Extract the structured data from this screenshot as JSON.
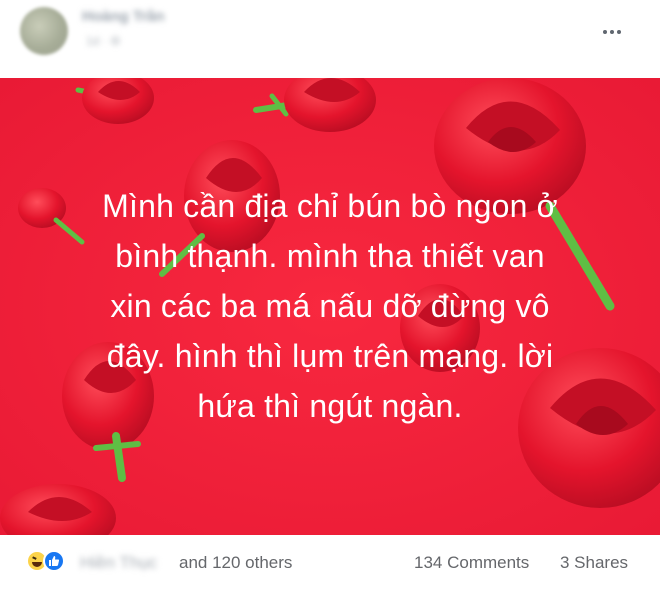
{
  "post": {
    "author_name": "Hoàng Trần",
    "meta": "1d · ⚙",
    "text_lines": [
      "Mình cần địa chỉ bún bò ngon ở",
      "bình thạnh. mình tha thiết van",
      "xin các ba má nấu dỡ đừng vô",
      "đây. hình thì lụm trên mạng. lời",
      "hứa thì ngút ngàn."
    ],
    "background_color": "#f0233a",
    "text_color": "#ffffff"
  },
  "reactions": {
    "icons": [
      "haha-icon",
      "like-icon"
    ],
    "reactor_name": "Hiền Thục",
    "others_label": "and 120 others",
    "comments_label": "134 Comments",
    "shares_label": "3 Shares"
  },
  "colors": {
    "muted_text": "#65676b",
    "like_blue": "#1877f2",
    "rose_red": "#e3132c"
  }
}
